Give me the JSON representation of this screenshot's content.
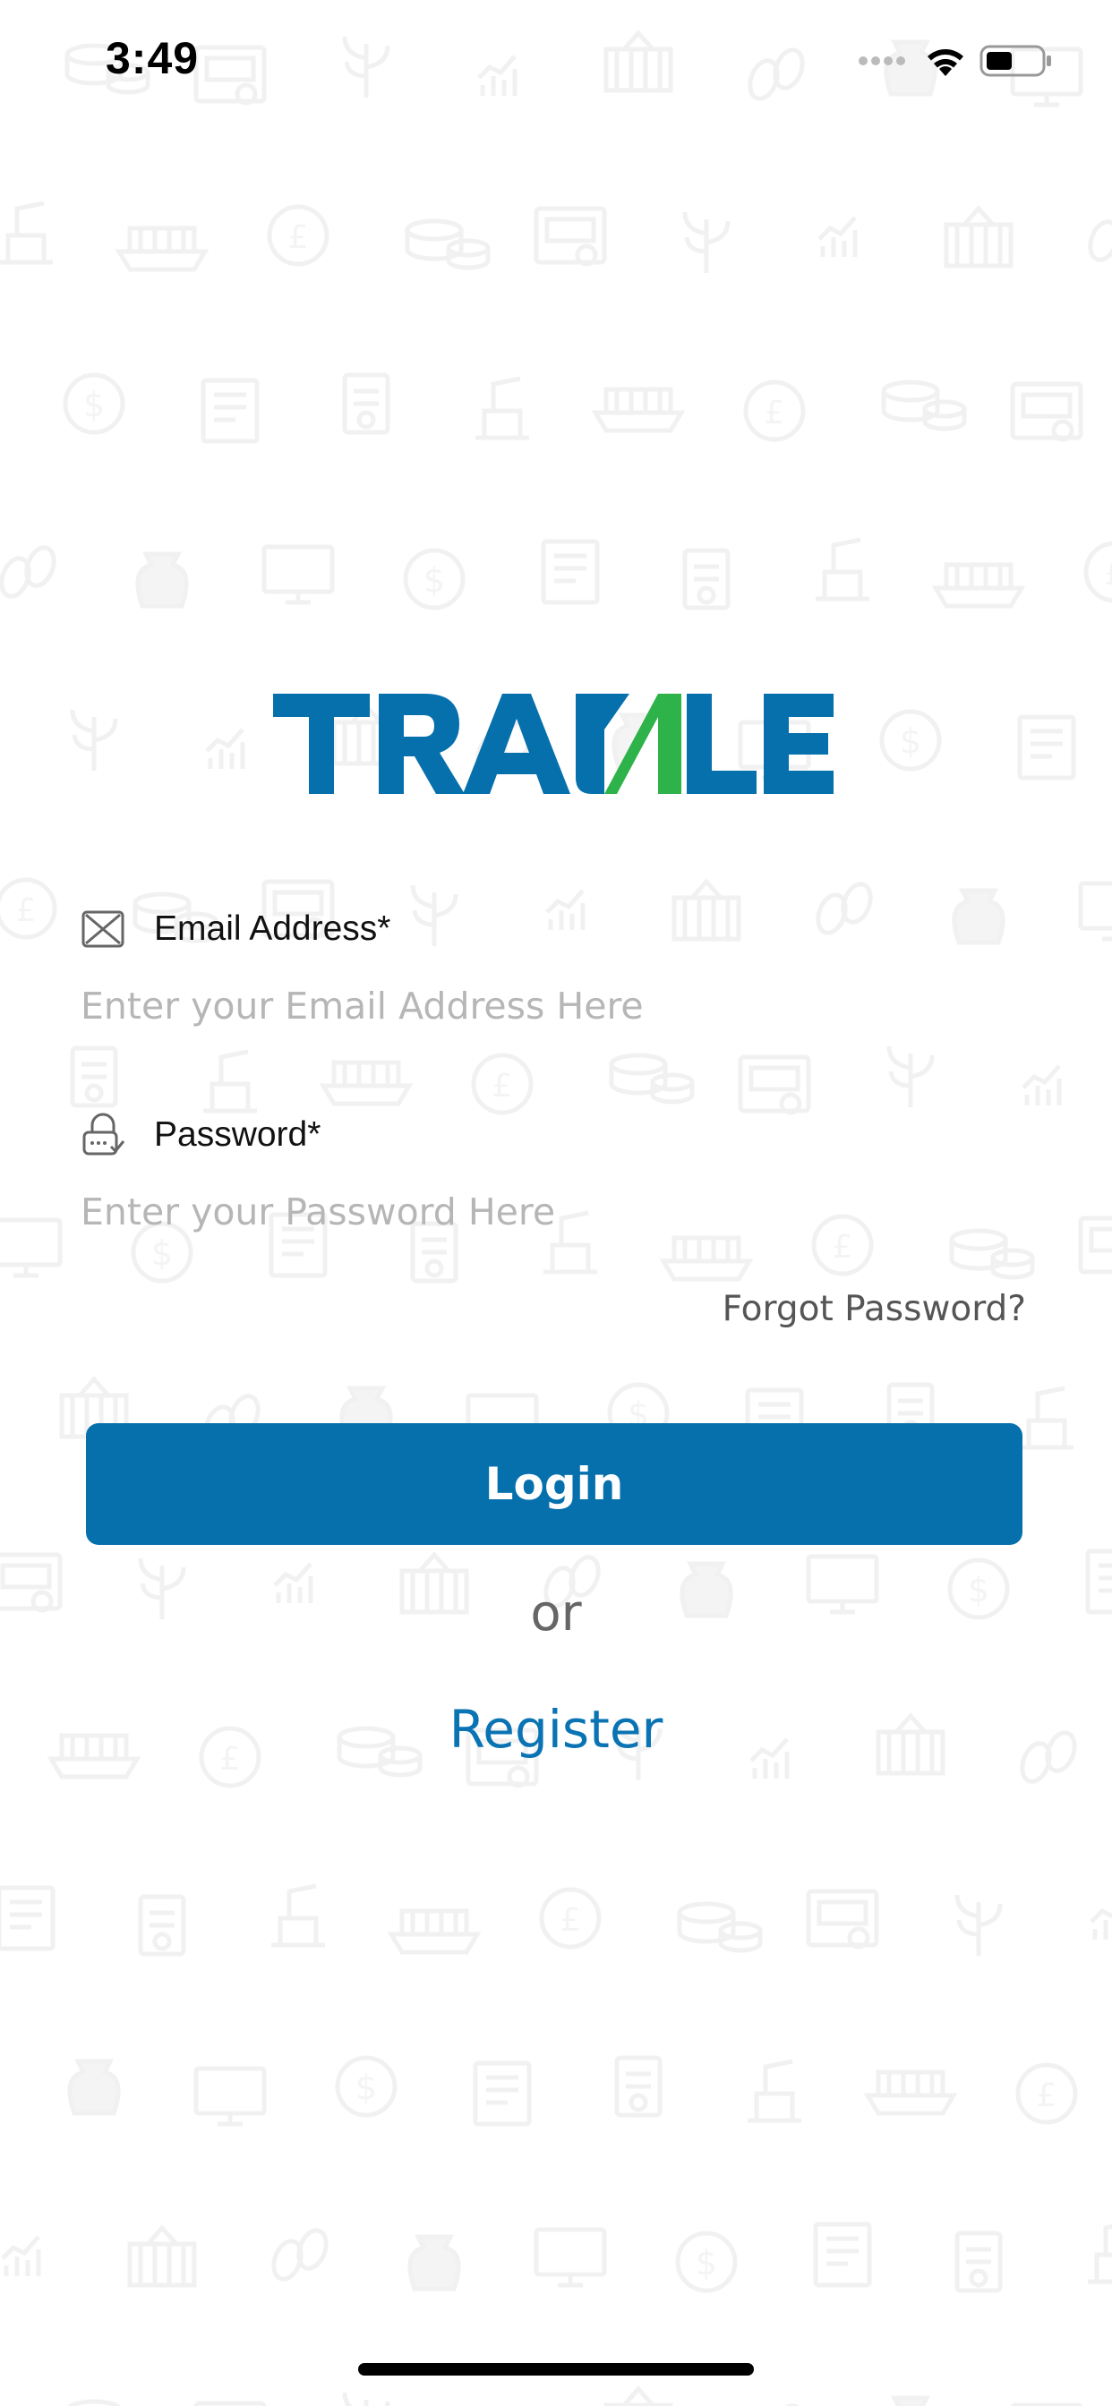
{
  "status_bar": {
    "time": "3:49",
    "icons": [
      "cellular-signal-icon",
      "wifi-icon",
      "battery-icon"
    ]
  },
  "brand": {
    "logo_text": "TRADLE",
    "colors": {
      "blue": "#0670ad",
      "green": "#2eb24a"
    }
  },
  "form": {
    "email": {
      "label": "Email Address*",
      "placeholder": "Enter your Email Address Here",
      "value": "",
      "icon": "envelope-icon"
    },
    "password": {
      "label": "Password*",
      "placeholder": "Enter your Password Here",
      "value": "",
      "icon": "lock-icon"
    },
    "forgot_password": "Forgot Password?",
    "login_label": "Login",
    "or_text": "or",
    "register_label": "Register"
  },
  "theme": {
    "primary": "#0670ad",
    "link": "#0a73b3",
    "placeholder": "#b6b6b6",
    "background": "#ffffff"
  }
}
